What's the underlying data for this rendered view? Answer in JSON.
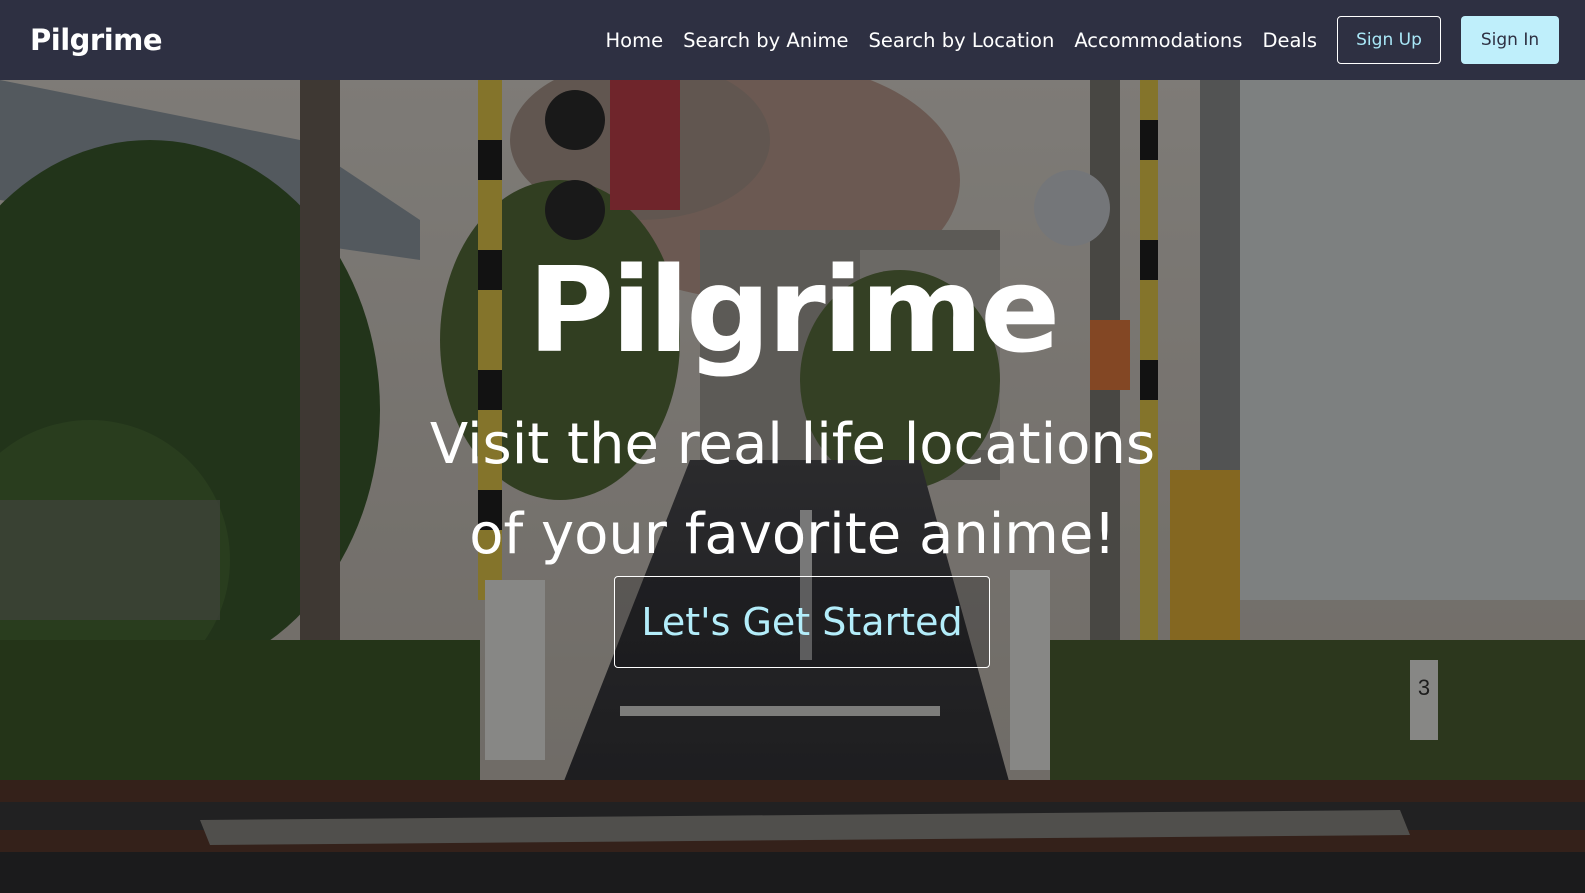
{
  "navbar": {
    "brand": "Pilgrime",
    "links": [
      "Home",
      "Search by Anime",
      "Search by Location",
      "Accommodations",
      "Deals"
    ],
    "signup_label": "Sign Up",
    "signin_label": "Sign In"
  },
  "hero": {
    "title": "Pilgrime",
    "tagline_line1": "Visit the real life locations",
    "tagline_line2": "of your favorite anime!",
    "cta_label": "Let's Get Started",
    "background_description_icon": "railway-crossing-photo",
    "sign_text": "3"
  },
  "colors": {
    "navbar_bg": "#2e3042",
    "accent": "#b3edfa",
    "signin_bg": "#bfeffb"
  }
}
